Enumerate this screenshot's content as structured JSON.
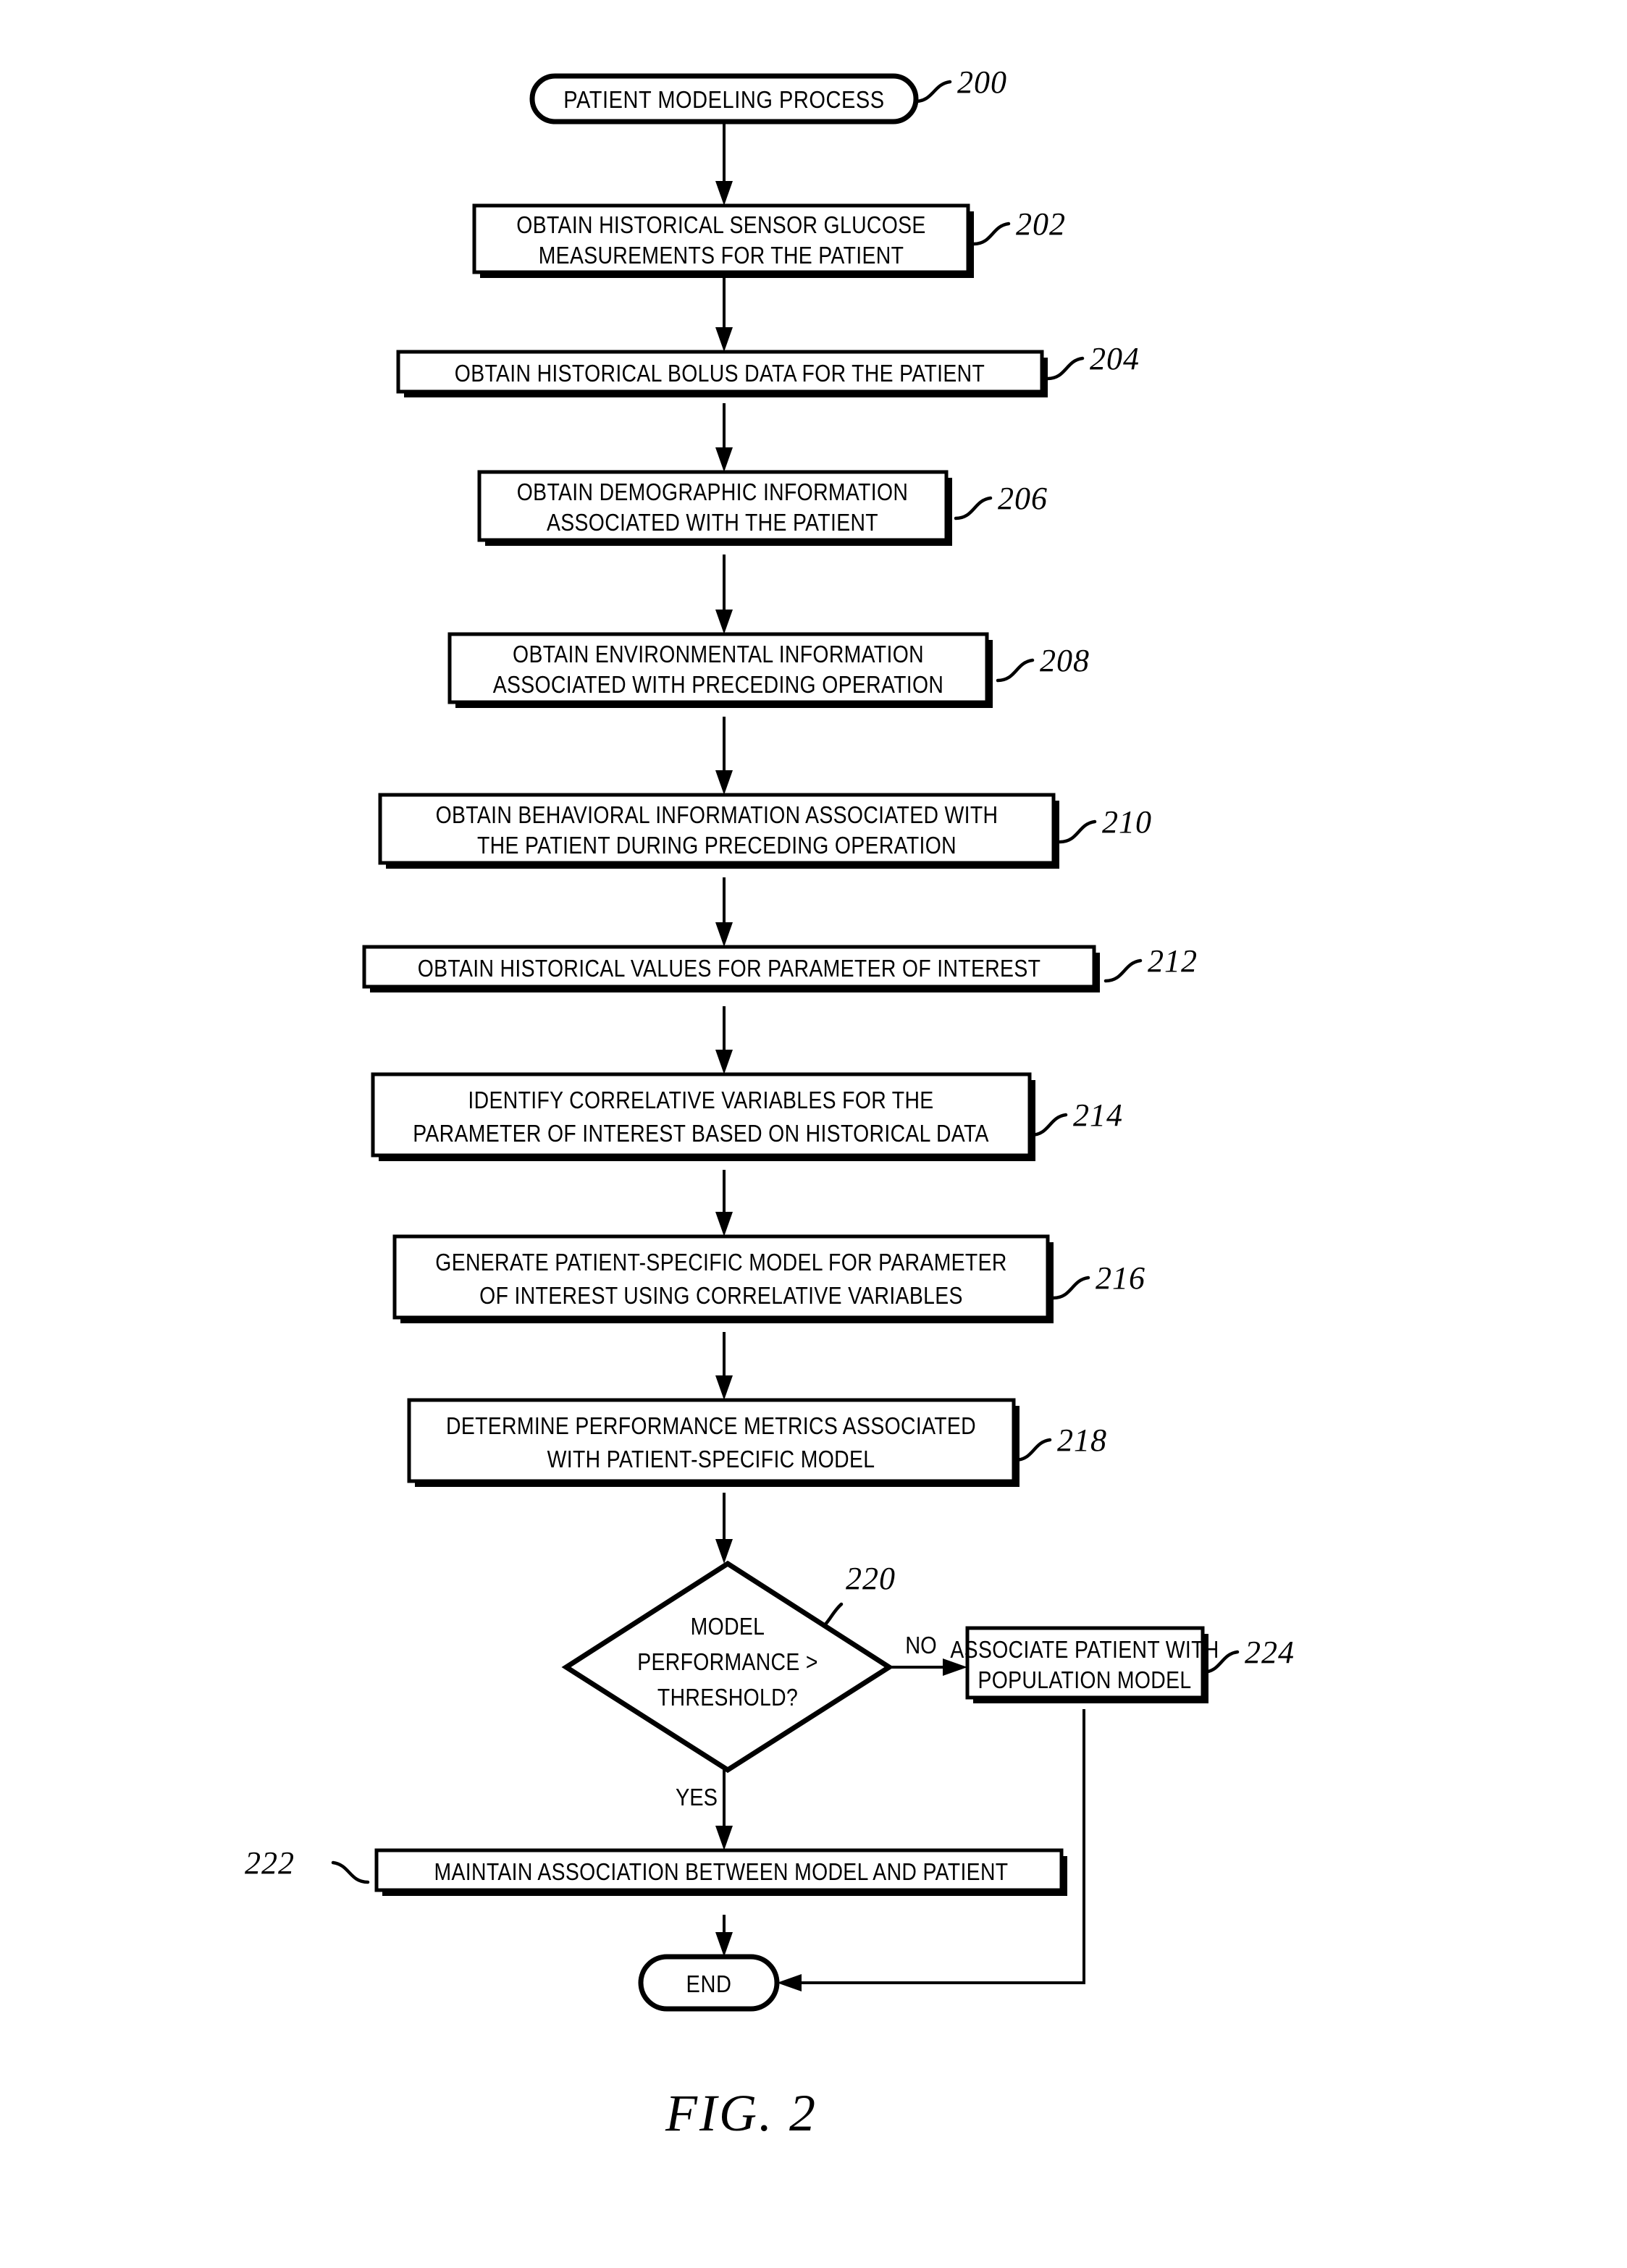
{
  "figure": {
    "caption": "FIG. 2",
    "title": "PATIENT MODELING PROCESS"
  },
  "nodes": {
    "start": {
      "ref": "200",
      "label": "PATIENT MODELING PROCESS",
      "shape": "terminator"
    },
    "n202": {
      "ref": "202",
      "shape": "process",
      "lines": [
        "OBTAIN HISTORICAL SENSOR GLUCOSE",
        "MEASUREMENTS FOR THE PATIENT"
      ]
    },
    "n204": {
      "ref": "204",
      "shape": "process",
      "lines": [
        "OBTAIN HISTORICAL BOLUS DATA FOR THE PATIENT"
      ]
    },
    "n206": {
      "ref": "206",
      "shape": "process",
      "lines": [
        "OBTAIN DEMOGRAPHIC INFORMATION",
        "ASSOCIATED WITH THE PATIENT"
      ]
    },
    "n208": {
      "ref": "208",
      "shape": "process",
      "lines": [
        "OBTAIN ENVIRONMENTAL INFORMATION",
        "ASSOCIATED WITH PRECEDING OPERATION"
      ]
    },
    "n210": {
      "ref": "210",
      "shape": "process",
      "lines": [
        "OBTAIN BEHAVIORAL INFORMATION ASSOCIATED WITH",
        "THE PATIENT DURING PRECEDING OPERATION"
      ]
    },
    "n212": {
      "ref": "212",
      "shape": "process",
      "lines": [
        "OBTAIN HISTORICAL VALUES FOR PARAMETER OF INTEREST"
      ]
    },
    "n214": {
      "ref": "214",
      "shape": "process",
      "lines": [
        "IDENTIFY CORRELATIVE VARIABLES FOR THE",
        "PARAMETER OF INTEREST BASED ON HISTORICAL DATA"
      ]
    },
    "n216": {
      "ref": "216",
      "shape": "process",
      "lines": [
        "GENERATE PATIENT-SPECIFIC MODEL FOR PARAMETER",
        "OF INTEREST USING CORRELATIVE VARIABLES"
      ]
    },
    "n218": {
      "ref": "218",
      "shape": "process",
      "lines": [
        "DETERMINE PERFORMANCE METRICS ASSOCIATED",
        "WITH PATIENT-SPECIFIC MODEL"
      ]
    },
    "n220": {
      "ref": "220",
      "shape": "decision",
      "lines": [
        "MODEL",
        "PERFORMANCE >",
        "THRESHOLD?"
      ]
    },
    "n222": {
      "ref": "222",
      "shape": "process",
      "lines": [
        "MAINTAIN ASSOCIATION BETWEEN MODEL AND PATIENT"
      ]
    },
    "n224": {
      "ref": "224",
      "shape": "process",
      "lines": [
        "ASSOCIATE PATIENT WITH",
        "POPULATION MODEL"
      ]
    },
    "end": {
      "label": "END",
      "shape": "terminator"
    }
  },
  "branch_labels": {
    "no": "NO",
    "yes": "YES"
  },
  "colors": {
    "stroke": "#000000",
    "fill": "#ffffff",
    "background": "#ffffff"
  }
}
